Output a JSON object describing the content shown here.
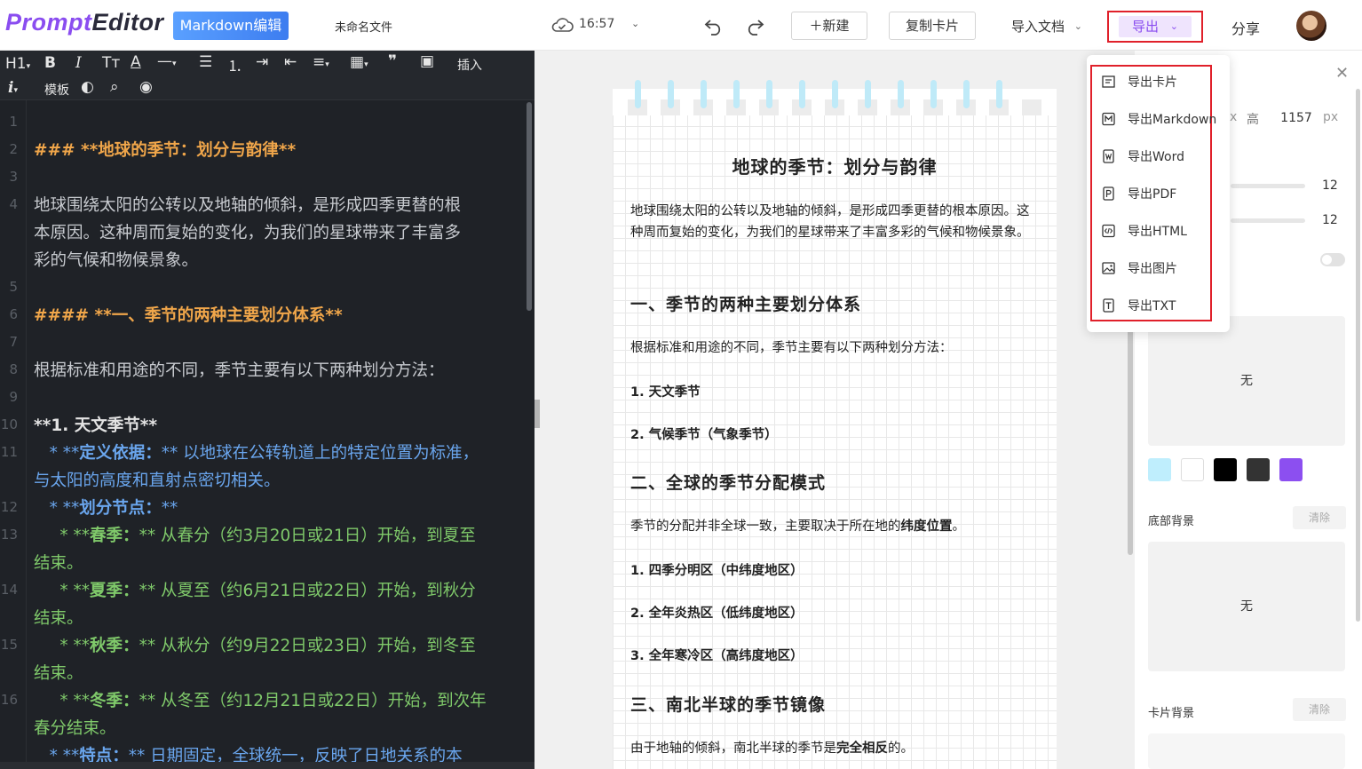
{
  "header": {
    "logo_part1": "Prompt",
    "logo_part2": "Editor",
    "mode_badge": "Markdown编辑",
    "filename": "未命名文件",
    "sync_time": "16:57",
    "new_button": "＋新建",
    "copy_card_button": "复制卡片",
    "import_button": "导入文档",
    "export_button": "导出",
    "share_button": "分享"
  },
  "toolbar": {
    "heading_label": "H1",
    "insert_label": "插入",
    "template_label": "模板"
  },
  "editor": {
    "line_numbers": [
      "1",
      "2",
      "3",
      "4",
      "",
      "",
      "5",
      "6",
      "7",
      "8",
      "9",
      "10",
      "11",
      "",
      "12",
      "13",
      "",
      "14",
      "",
      "15",
      "",
      "16",
      "",
      ""
    ],
    "lines": {
      "l2": "### **地球的季节：划分与韵律**",
      "l4a": "地球围绕太阳的公转以及地轴的倾斜，是形成四季更替的根",
      "l4b": "本原因。这种周而复始的变化，为我们的星球带来了丰富多",
      "l4c": "彩的气候和物候景象。",
      "l6": "#### **一、季节的两种主要划分体系**",
      "l8": "根据标准和用途的不同，季节主要有以下两种划分方法：",
      "l10": "**1. 天文季节**",
      "l11_prefix": "   * **",
      "l11_key": "定义依据：",
      "l11_suffix": "** 以地球在公转轨道上的特定位置为标准，",
      "l11b": "与太阳的高度和直射点密切相关。",
      "l12_prefix": "   * **",
      "l12_key": "划分节点：",
      "l12_suffix": "**",
      "l13_prefix": "     * **",
      "l13_key": "春季：",
      "l13_suffix": "** 从春分（约3月20日或21日）开始，到夏至",
      "l13b": "结束。",
      "l14_prefix": "     * **",
      "l14_key": "夏季：",
      "l14_suffix": "** 从夏至（约6月21日或22日）开始，到秋分",
      "l14b": "结束。",
      "l15_prefix": "     * **",
      "l15_key": "秋季：",
      "l15_suffix": "** 从秋分（约9月22日或23日）开始，到冬至",
      "l15b": "结束。",
      "l16_prefix": "     * **",
      "l16_key": "冬季：",
      "l16_suffix": "** 从冬至（约12月21日或22日）开始，到次年",
      "l16b": "春分结束。",
      "l17_prefix": "   * **",
      "l17_key": "特点：",
      "l17_suffix": "** 日期固定，全球统一，反映了日地关系的本"
    }
  },
  "preview": {
    "title": "地球的季节：划分与韵律",
    "intro": "地球围绕太阳的公转以及地轴的倾斜，是形成四季更替的根本原因。这种周而复始的变化，为我们的星球带来了丰富多彩的气候和物候景象。",
    "h_1": "一、季节的两种主要划分体系",
    "p_1": "根据标准和用途的不同，季节主要有以下两种划分方法：",
    "li_1": "1. 天文季节",
    "li_2": "2. 气候季节（气象季节）",
    "h_2": "二、全球的季节分配模式",
    "p_2_a": "季节的分配并非全球一致，主要取决于所在地的",
    "p_2_b": "纬度位置",
    "p_2_c": "。",
    "li_3": "1. 四季分明区（中纬度地区）",
    "li_4": "2. 全年炎热区（低纬度地区）",
    "li_5": "3. 全年寒冷区（高纬度地区）",
    "h_3": "三、南北半球的季节镜像",
    "p_3_a": "由于地轴的倾斜，南北半球的季节是",
    "p_3_b": "完全相反",
    "p_3_c": "的。"
  },
  "export_menu": {
    "items": [
      {
        "label": "导出卡片",
        "icon": "card-icon"
      },
      {
        "label": "导出Markdown",
        "icon": "markdown-icon"
      },
      {
        "label": "导出Word",
        "icon": "word-icon"
      },
      {
        "label": "导出PDF",
        "icon": "pdf-icon"
      },
      {
        "label": "导出HTML",
        "icon": "html-icon"
      },
      {
        "label": "导出图片",
        "icon": "image-icon"
      },
      {
        "label": "导出TXT",
        "icon": "txt-icon"
      }
    ]
  },
  "panel": {
    "size_unit_partial": "x",
    "height_label": "高",
    "height_value": "1157",
    "height_unit": "px",
    "slider1_value": "12",
    "slider2_value": "12",
    "top_bg_value": "无",
    "swatches": [
      "#bfeefd",
      "#ffffff",
      "#000000",
      "#333333",
      "#8c4ff0"
    ],
    "bottom_bg_label": "底部背景",
    "bottom_clear": "清除",
    "bottom_bg_value": "无",
    "card_bg_label": "卡片背景",
    "card_clear": "清除"
  },
  "colors": {
    "accent_purple": "#8a4df0",
    "highlight_red": "#e0202a",
    "editor_bg": "#1f2227"
  }
}
